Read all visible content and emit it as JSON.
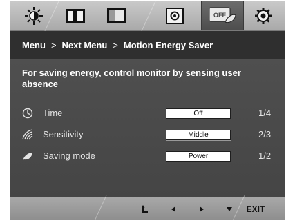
{
  "tabs": [
    {
      "icon": "brightness-icon",
      "active": false
    },
    {
      "icon": "contrast-icon",
      "active": false
    },
    {
      "icon": "picture-icon",
      "active": false
    },
    {
      "icon": "record-icon",
      "active": false
    },
    {
      "icon": "energy-saver-icon",
      "label": "OFF",
      "active": true
    },
    {
      "icon": "settings-gear-icon",
      "active": false
    }
  ],
  "breadcrumb": {
    "menu": "Menu",
    "next_menu": "Next Menu",
    "current": "Motion Energy Saver",
    "separator": ">"
  },
  "description": "For saving energy, control monitor by sensing user absence",
  "settings": [
    {
      "icon": "clock-icon",
      "label": "Time",
      "value": "Off",
      "position": "1/4"
    },
    {
      "icon": "sensitivity-icon",
      "label": "Sensitivity",
      "value": "Middle",
      "position": "2/3"
    },
    {
      "icon": "leaf-icon",
      "label": "Saving mode",
      "value": "Power",
      "position": "1/2"
    }
  ],
  "bottom_nav": {
    "enter_icon": "enter-icon",
    "left_icon": "left-arrow-icon",
    "right_icon": "right-arrow-icon",
    "down_icon": "down-arrow-icon",
    "exit_label": "EXIT"
  }
}
